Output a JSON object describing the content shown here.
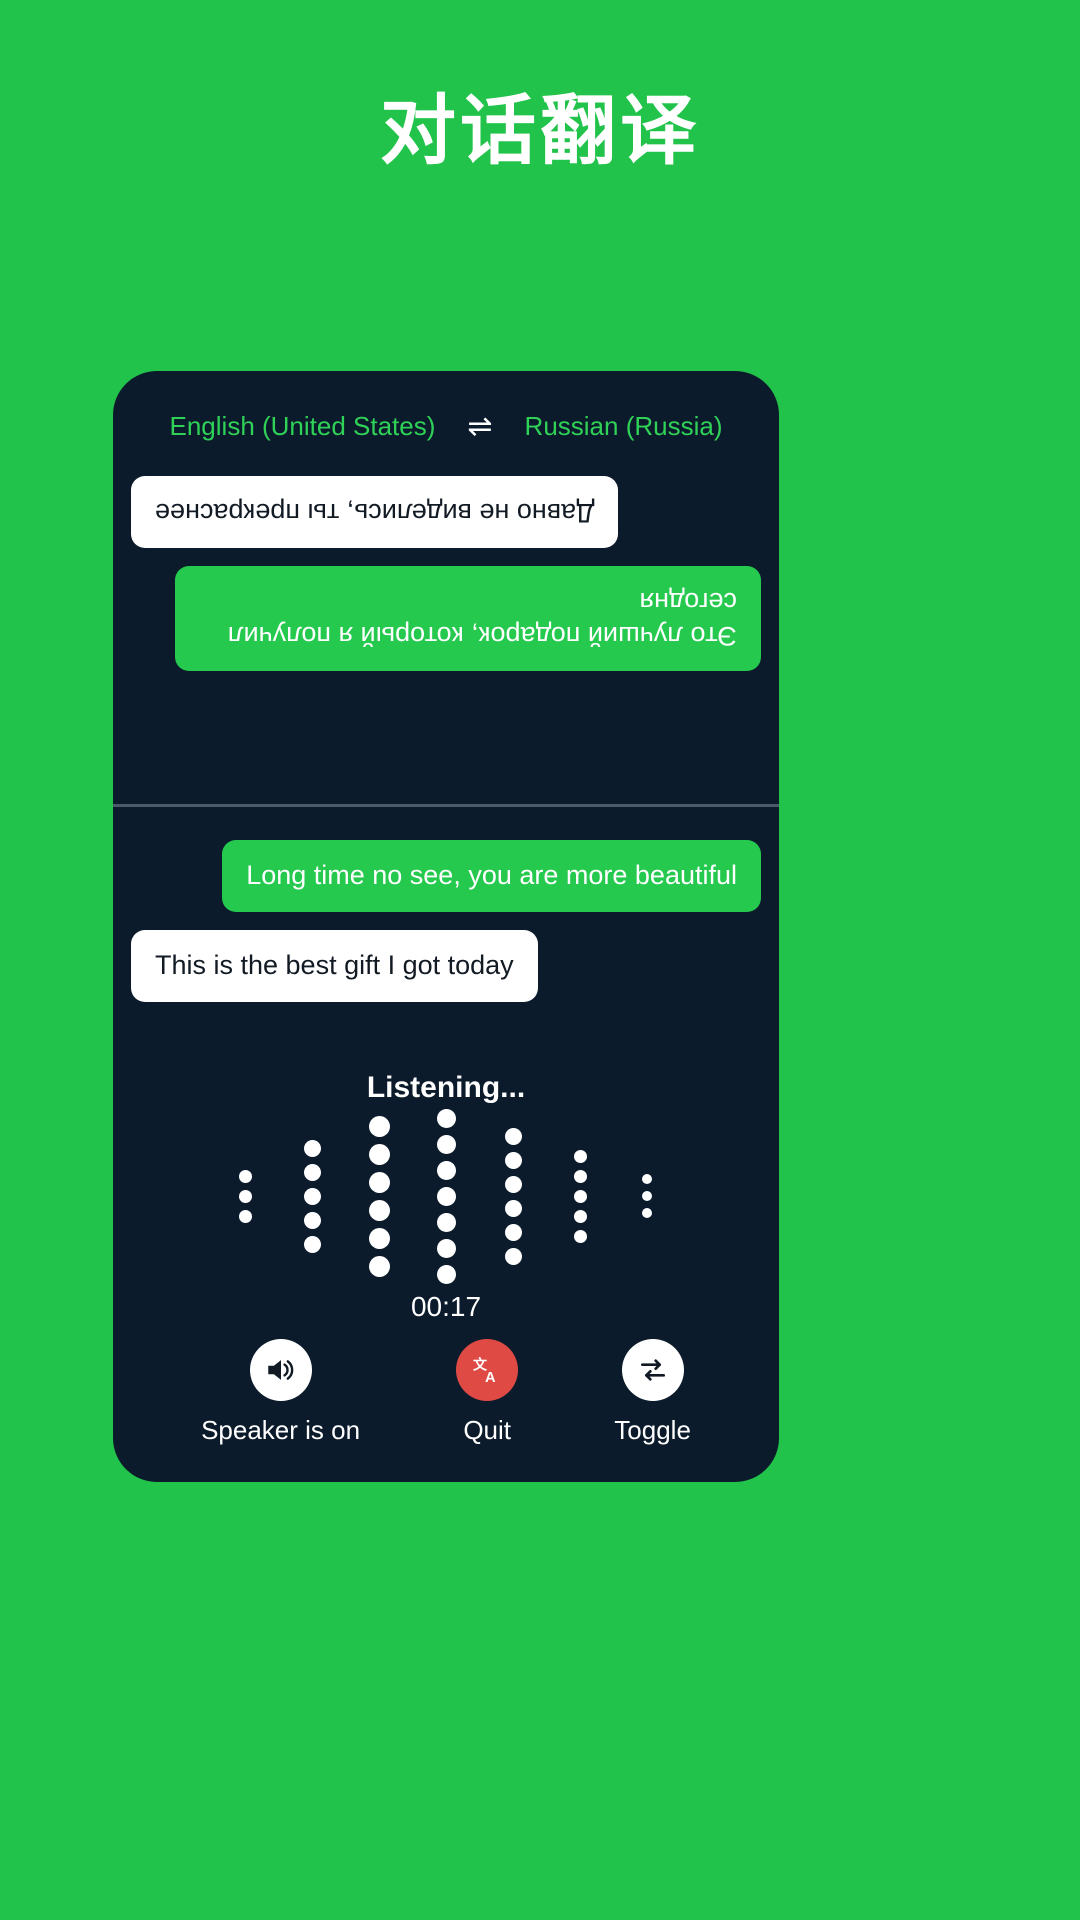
{
  "page": {
    "title": "对话翻译",
    "background_color": "#22c34a",
    "panel_color": "#0b1b2b",
    "accent_green": "#24c94d",
    "danger_red": "#df4a45"
  },
  "language_bar": {
    "source_language": "English (United States)",
    "swap_icon": "swap-horizontal-icon",
    "swap_glyph": "⇌",
    "target_language": "Russian (Russia)"
  },
  "conversation": {
    "remote_panel": {
      "rotated": true,
      "messages": [
        {
          "text": "Это лучший подарок, который я получил сегодня",
          "style": "green",
          "align": "left"
        },
        {
          "text": "Давно не виделись, ты прекраснее",
          "style": "white",
          "align": "right"
        }
      ]
    },
    "local_panel": {
      "rotated": false,
      "messages": [
        {
          "text": "Long time no see, you are more beautiful",
          "style": "green",
          "align": "right"
        },
        {
          "text": "This is the best gift I got today",
          "style": "white",
          "align": "left"
        }
      ]
    }
  },
  "status": {
    "listening_label": "Listening...",
    "timer": "00:17"
  },
  "visualizer": {
    "columns": [
      {
        "count": 3,
        "size": 13
      },
      {
        "count": 5,
        "size": 17
      },
      {
        "count": 6,
        "size": 21
      },
      {
        "count": 7,
        "size": 19
      },
      {
        "count": 6,
        "size": 17
      },
      {
        "count": 5,
        "size": 13
      },
      {
        "count": 3,
        "size": 10
      }
    ]
  },
  "controls": [
    {
      "label": "Speaker is on",
      "icon": "speaker-on-icon",
      "style": "light",
      "name": "speaker-button"
    },
    {
      "label": "Quit",
      "icon": "translate-icon",
      "style": "danger",
      "name": "quit-button"
    },
    {
      "label": "Toggle",
      "icon": "toggle-swap-icon",
      "style": "light",
      "name": "toggle-button"
    }
  ]
}
